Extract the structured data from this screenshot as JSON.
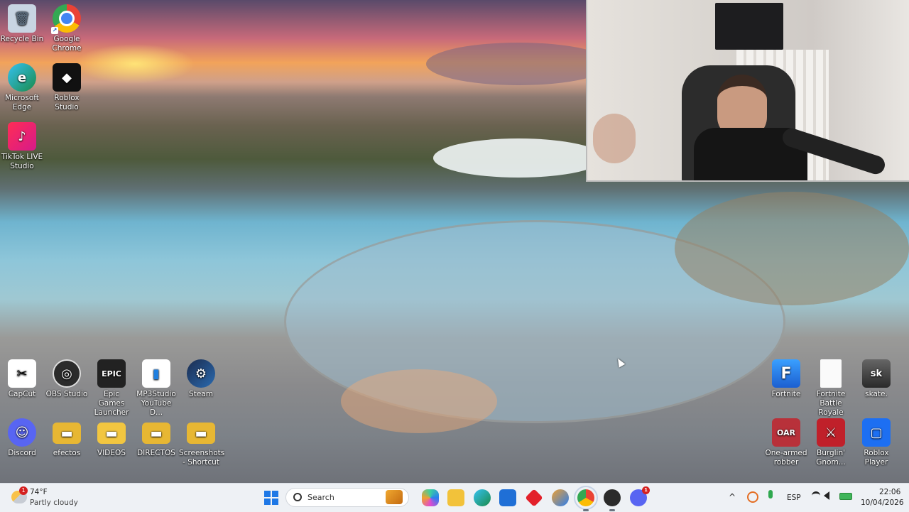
{
  "desktop_icons": [
    {
      "label": "Recycle Bin",
      "icon": "recycle-bin-icon",
      "color": "#d8e3ee"
    },
    {
      "label": "Google Chrome",
      "icon": "chrome-icon",
      "color": "#e8453c"
    },
    {
      "label": "Microsoft Edge",
      "icon": "edge-icon",
      "color": "#1aa0c8"
    },
    {
      "label": "Roblox Studio",
      "icon": "roblox-studio-icon",
      "color": "#101010"
    },
    {
      "label": "TikTok LIVE Studio",
      "icon": "tiktok-icon",
      "color": "#e21a4a"
    },
    {
      "label": "CapCut",
      "icon": "capcut-icon",
      "color": "#ffffff"
    },
    {
      "label": "OBS Studio",
      "icon": "obs-icon",
      "color": "#2a2a2a"
    },
    {
      "label": "Epic Games Launcher",
      "icon": "epic-games-icon",
      "color": "#222222"
    },
    {
      "label": "MP3Studio YouTube D...",
      "icon": "mp3studio-icon",
      "color": "#1f7fe0"
    },
    {
      "label": "Steam",
      "icon": "steam-icon",
      "color": "#1b3b6f"
    },
    {
      "label": "Discord",
      "icon": "discord-icon",
      "color": "#5865f2"
    },
    {
      "label": "efectos",
      "icon": "folder-icon",
      "color": "#e7b733"
    },
    {
      "label": "VIDEOS",
      "icon": "folder-icon",
      "color": "#f2c640"
    },
    {
      "label": "DIRECTOS",
      "icon": "folder-icon",
      "color": "#e7b733"
    },
    {
      "label": "Screenshots - Shortcut",
      "icon": "folder-icon",
      "color": "#e7b733"
    },
    {
      "label": "Fortnite",
      "icon": "fortnite-icon",
      "color": "#2f7fe0"
    },
    {
      "label": "Fortnite Battle Royale",
      "icon": "file-icon",
      "color": "#ffffff"
    },
    {
      "label": "skate.",
      "icon": "skate-icon",
      "color": "#3a3a3a"
    },
    {
      "label": "One-armed robber",
      "icon": "one-armed-robber-icon",
      "color": "#b8313a"
    },
    {
      "label": "Burglin' Gnom...",
      "icon": "burglin-gnomes-icon",
      "color": "#c0202a"
    },
    {
      "label": "Roblox Player",
      "icon": "roblox-player-icon",
      "color": "#1d6ff2"
    }
  ],
  "icon_glyphs": {
    "recycle": "🗑",
    "chrome": "◉",
    "edge": "e",
    "rstudio": "◆",
    "tiktok": "♪",
    "capcut": "✂",
    "obs": "◎",
    "epic": "EPIC",
    "mp3": "▮",
    "steam": "⚙",
    "discord": "☺",
    "f1": "▬",
    "f2": "▬",
    "f3": "▬",
    "f4": "▬",
    "fortnite": "F",
    "fbr": "",
    "skate": "sk",
    "robber": "OAR",
    "gnome": "⚔",
    "rplayer": "▢"
  },
  "shortcut_arrow": "↗",
  "weather": {
    "temp": "74°F",
    "desc": "Partly cloudy",
    "badge": "1"
  },
  "taskbar": {
    "search_placeholder": "Search",
    "apps": [
      "start-icon",
      "search-icon",
      "widgets-icon",
      "copilot-icon",
      "file-explorer-icon",
      "edge-icon",
      "microsoft-store-icon",
      "app-icon",
      "onedrive-icon",
      "chrome-icon",
      "obs-icon",
      "discord-icon"
    ],
    "discord_badge": "1"
  },
  "tray": {
    "language": "ESP",
    "time": "22:06",
    "date": "10/04/2026"
  }
}
